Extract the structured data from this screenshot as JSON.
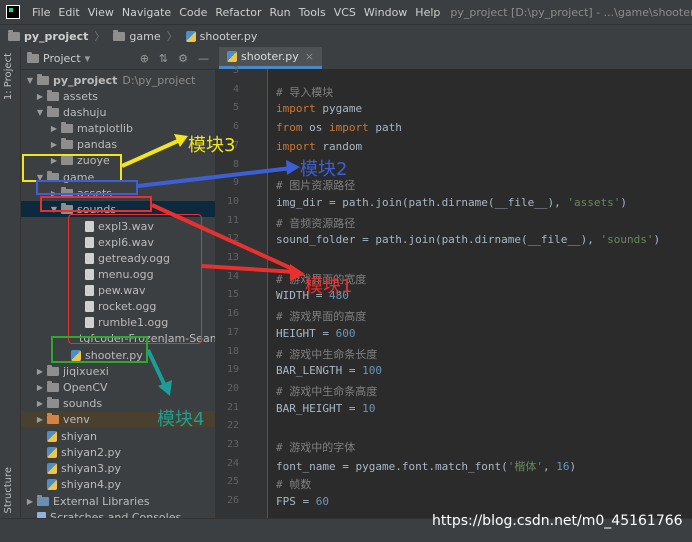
{
  "menubar": {
    "items": [
      "File",
      "Edit",
      "View",
      "Navigate",
      "Code",
      "Refactor",
      "Run",
      "Tools",
      "VCS",
      "Window",
      "Help"
    ],
    "window_title": "py_project [D:\\py_project] - ...\\game\\shooter.py - PyCh"
  },
  "navbar": {
    "crumbs": [
      "py_project",
      "game",
      "shooter.py"
    ]
  },
  "left_strip": {
    "project_tab": "1: Project",
    "structure_tab": "Z: Structure"
  },
  "project_panel": {
    "title": "Project",
    "tree": [
      {
        "label": "py_project",
        "path": "D:\\py_project",
        "icon": "folder",
        "arrow": "▼"
      },
      {
        "label": "assets",
        "icon": "folder",
        "arrow": "▶"
      },
      {
        "label": "dashuju",
        "icon": "folder",
        "arrow": "▼"
      },
      {
        "label": "matplotlib",
        "icon": "folder",
        "arrow": "▶"
      },
      {
        "label": "pandas",
        "icon": "folder",
        "arrow": "▶"
      },
      {
        "label": "zuoye",
        "icon": "folder",
        "arrow": "▶"
      },
      {
        "label": "game",
        "icon": "folder",
        "arrow": "▼"
      },
      {
        "label": "assets",
        "icon": "folder",
        "arrow": "▶"
      },
      {
        "label": "sounds",
        "icon": "folder",
        "arrow": "▼"
      },
      {
        "label": "expl3.wav",
        "icon": "file",
        "arrow": ""
      },
      {
        "label": "expl6.wav",
        "icon": "file",
        "arrow": ""
      },
      {
        "label": "getready.ogg",
        "icon": "file",
        "arrow": ""
      },
      {
        "label": "menu.ogg",
        "icon": "file",
        "arrow": ""
      },
      {
        "label": "pew.wav",
        "icon": "file",
        "arrow": ""
      },
      {
        "label": "rocket.ogg",
        "icon": "file",
        "arrow": ""
      },
      {
        "label": "rumble1.ogg",
        "icon": "file",
        "arrow": ""
      },
      {
        "label": "tgfcoder-FrozenJam-SeamlessLoop.ogg",
        "icon": "file",
        "arrow": ""
      },
      {
        "label": "shooter.py",
        "icon": "python-file",
        "arrow": ""
      },
      {
        "label": "jiqixuexi",
        "icon": "folder",
        "arrow": "▶"
      },
      {
        "label": "OpenCV",
        "icon": "folder",
        "arrow": "▶"
      },
      {
        "label": "sounds",
        "icon": "folder",
        "arrow": "▶"
      },
      {
        "label": "venv",
        "icon": "folder",
        "arrow": "▶"
      },
      {
        "label": "shiyan",
        "icon": "python-file",
        "arrow": ""
      },
      {
        "label": "shiyan2.py",
        "icon": "python-file",
        "arrow": ""
      },
      {
        "label": "shiyan3.py",
        "icon": "python-file",
        "arrow": ""
      },
      {
        "label": "shiyan4.py",
        "icon": "python-file",
        "arrow": ""
      },
      {
        "label": "External Libraries",
        "icon": "library",
        "arrow": "▶"
      },
      {
        "label": "Scratches and Consoles",
        "icon": "scratch",
        "arrow": ""
      }
    ]
  },
  "editor": {
    "tab": "shooter.py",
    "lines": [
      {
        "n": "3",
        "t": []
      },
      {
        "n": "4",
        "t": [
          [
            "cm",
            "# 导入模块"
          ]
        ]
      },
      {
        "n": "5",
        "t": [
          [
            "kw",
            "import"
          ],
          [
            "pl",
            " pygame"
          ]
        ]
      },
      {
        "n": "6",
        "t": [
          [
            "kw",
            "from"
          ],
          [
            "pl",
            " os "
          ],
          [
            "kw",
            "import"
          ],
          [
            "pl",
            " path"
          ]
        ]
      },
      {
        "n": "7",
        "t": [
          [
            "kw",
            "import"
          ],
          [
            "pl",
            " random"
          ]
        ]
      },
      {
        "n": "8",
        "t": []
      },
      {
        "n": "9",
        "t": [
          [
            "cm",
            "# 图片资源路径"
          ]
        ]
      },
      {
        "n": "10",
        "t": [
          [
            "pl",
            "img_dir = path.join(path.dirname(__file__), "
          ],
          [
            "str",
            "'assets'"
          ],
          [
            "pl",
            ")"
          ]
        ]
      },
      {
        "n": "11",
        "t": [
          [
            "cm",
            "# 音频资源路径"
          ]
        ]
      },
      {
        "n": "12",
        "t": [
          [
            "pl",
            "sound_folder = path.join(path.dirname(__file__), "
          ],
          [
            "str",
            "'sounds'"
          ],
          [
            "pl",
            ")"
          ]
        ]
      },
      {
        "n": "13",
        "t": []
      },
      {
        "n": "14",
        "t": [
          [
            "cm",
            "# 游戏界面的宽度"
          ]
        ]
      },
      {
        "n": "15",
        "t": [
          [
            "pl",
            "WIDTH = "
          ],
          [
            "num",
            "480"
          ]
        ]
      },
      {
        "n": "16",
        "t": [
          [
            "cm",
            "# 游戏界面的高度"
          ]
        ]
      },
      {
        "n": "17",
        "t": [
          [
            "pl",
            "HEIGHT = "
          ],
          [
            "num",
            "600"
          ]
        ]
      },
      {
        "n": "18",
        "t": [
          [
            "cm",
            "# 游戏中生命条长度"
          ]
        ]
      },
      {
        "n": "19",
        "t": [
          [
            "pl",
            "BAR_LENGTH = "
          ],
          [
            "num",
            "100"
          ]
        ]
      },
      {
        "n": "20",
        "t": [
          [
            "cm",
            "# 游戏中生命条高度"
          ]
        ]
      },
      {
        "n": "21",
        "t": [
          [
            "pl",
            "BAR_HEIGHT = "
          ],
          [
            "num",
            "10"
          ]
        ]
      },
      {
        "n": "22",
        "t": []
      },
      {
        "n": "23",
        "t": [
          [
            "cm",
            "# 游戏中的字体"
          ]
        ]
      },
      {
        "n": "24",
        "t": [
          [
            "pl",
            "font_name = pygame.font.match_font("
          ],
          [
            "str",
            "'楷体'"
          ],
          [
            "pl",
            ", "
          ],
          [
            "num",
            "16"
          ],
          [
            "pl",
            ")"
          ]
        ]
      },
      {
        "n": "25",
        "t": [
          [
            "cm",
            "# 帧数"
          ]
        ]
      },
      {
        "n": "26",
        "t": [
          [
            "pl",
            "FPS = "
          ],
          [
            "num",
            "60"
          ]
        ]
      }
    ]
  },
  "annotations": {
    "module1": "模块1",
    "module2": "模块2",
    "module3": "模块3",
    "module4": "模块4"
  },
  "watermark": "https://blog.csdn.net/m0_45161766",
  "colors": {
    "module1": "#e8312f",
    "module2": "#3c5fd6",
    "module3": "#f2e51b",
    "module4": "#1b9e99",
    "green_box": "#2fa82f"
  }
}
